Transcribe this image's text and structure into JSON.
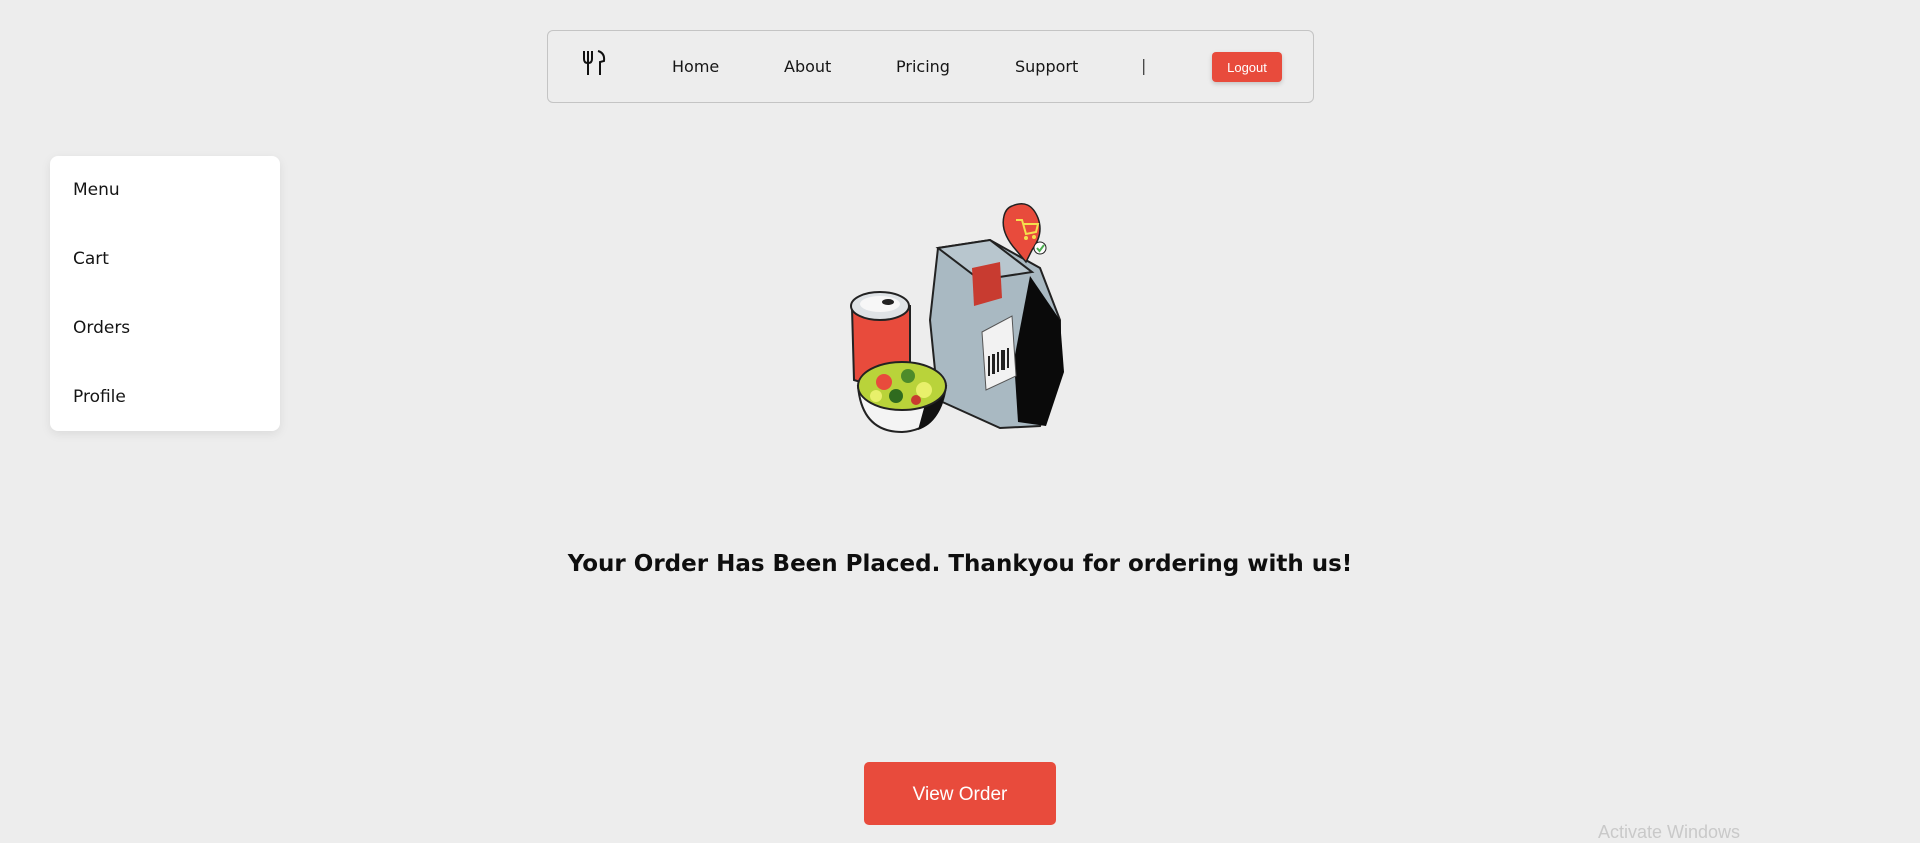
{
  "navbar": {
    "logo_icon": "fork-knife-icon",
    "links": [
      "Home",
      "About",
      "Pricing",
      "Support"
    ],
    "separator": "|",
    "logout_label": "Logout"
  },
  "sidebar": {
    "items": [
      "Menu",
      "Cart",
      "Orders",
      "Profile"
    ]
  },
  "main": {
    "illustration_icon": "food-delivery-bag-icon",
    "message": "Your Order Has Been Placed. Thankyou for ordering with us!",
    "view_order_label": "View Order"
  },
  "watermark": {
    "text": "Activate Windows"
  },
  "colors": {
    "accent": "#e84b3c",
    "background": "#ededed",
    "sidebar_bg": "#ffffff"
  }
}
